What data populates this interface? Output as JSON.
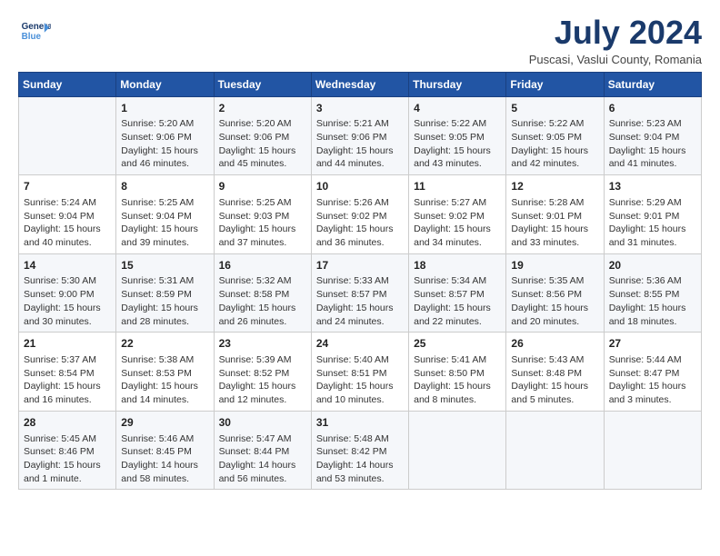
{
  "header": {
    "logo_line1": "General",
    "logo_line2": "Blue",
    "month": "July 2024",
    "location": "Puscasi, Vaslui County, Romania"
  },
  "days_of_week": [
    "Sunday",
    "Monday",
    "Tuesday",
    "Wednesday",
    "Thursday",
    "Friday",
    "Saturday"
  ],
  "weeks": [
    [
      {
        "day": "",
        "info": ""
      },
      {
        "day": "1",
        "info": "Sunrise: 5:20 AM\nSunset: 9:06 PM\nDaylight: 15 hours\nand 46 minutes."
      },
      {
        "day": "2",
        "info": "Sunrise: 5:20 AM\nSunset: 9:06 PM\nDaylight: 15 hours\nand 45 minutes."
      },
      {
        "day": "3",
        "info": "Sunrise: 5:21 AM\nSunset: 9:06 PM\nDaylight: 15 hours\nand 44 minutes."
      },
      {
        "day": "4",
        "info": "Sunrise: 5:22 AM\nSunset: 9:05 PM\nDaylight: 15 hours\nand 43 minutes."
      },
      {
        "day": "5",
        "info": "Sunrise: 5:22 AM\nSunset: 9:05 PM\nDaylight: 15 hours\nand 42 minutes."
      },
      {
        "day": "6",
        "info": "Sunrise: 5:23 AM\nSunset: 9:04 PM\nDaylight: 15 hours\nand 41 minutes."
      }
    ],
    [
      {
        "day": "7",
        "info": "Sunrise: 5:24 AM\nSunset: 9:04 PM\nDaylight: 15 hours\nand 40 minutes."
      },
      {
        "day": "8",
        "info": "Sunrise: 5:25 AM\nSunset: 9:04 PM\nDaylight: 15 hours\nand 39 minutes."
      },
      {
        "day": "9",
        "info": "Sunrise: 5:25 AM\nSunset: 9:03 PM\nDaylight: 15 hours\nand 37 minutes."
      },
      {
        "day": "10",
        "info": "Sunrise: 5:26 AM\nSunset: 9:02 PM\nDaylight: 15 hours\nand 36 minutes."
      },
      {
        "day": "11",
        "info": "Sunrise: 5:27 AM\nSunset: 9:02 PM\nDaylight: 15 hours\nand 34 minutes."
      },
      {
        "day": "12",
        "info": "Sunrise: 5:28 AM\nSunset: 9:01 PM\nDaylight: 15 hours\nand 33 minutes."
      },
      {
        "day": "13",
        "info": "Sunrise: 5:29 AM\nSunset: 9:01 PM\nDaylight: 15 hours\nand 31 minutes."
      }
    ],
    [
      {
        "day": "14",
        "info": "Sunrise: 5:30 AM\nSunset: 9:00 PM\nDaylight: 15 hours\nand 30 minutes."
      },
      {
        "day": "15",
        "info": "Sunrise: 5:31 AM\nSunset: 8:59 PM\nDaylight: 15 hours\nand 28 minutes."
      },
      {
        "day": "16",
        "info": "Sunrise: 5:32 AM\nSunset: 8:58 PM\nDaylight: 15 hours\nand 26 minutes."
      },
      {
        "day": "17",
        "info": "Sunrise: 5:33 AM\nSunset: 8:57 PM\nDaylight: 15 hours\nand 24 minutes."
      },
      {
        "day": "18",
        "info": "Sunrise: 5:34 AM\nSunset: 8:57 PM\nDaylight: 15 hours\nand 22 minutes."
      },
      {
        "day": "19",
        "info": "Sunrise: 5:35 AM\nSunset: 8:56 PM\nDaylight: 15 hours\nand 20 minutes."
      },
      {
        "day": "20",
        "info": "Sunrise: 5:36 AM\nSunset: 8:55 PM\nDaylight: 15 hours\nand 18 minutes."
      }
    ],
    [
      {
        "day": "21",
        "info": "Sunrise: 5:37 AM\nSunset: 8:54 PM\nDaylight: 15 hours\nand 16 minutes."
      },
      {
        "day": "22",
        "info": "Sunrise: 5:38 AM\nSunset: 8:53 PM\nDaylight: 15 hours\nand 14 minutes."
      },
      {
        "day": "23",
        "info": "Sunrise: 5:39 AM\nSunset: 8:52 PM\nDaylight: 15 hours\nand 12 minutes."
      },
      {
        "day": "24",
        "info": "Sunrise: 5:40 AM\nSunset: 8:51 PM\nDaylight: 15 hours\nand 10 minutes."
      },
      {
        "day": "25",
        "info": "Sunrise: 5:41 AM\nSunset: 8:50 PM\nDaylight: 15 hours\nand 8 minutes."
      },
      {
        "day": "26",
        "info": "Sunrise: 5:43 AM\nSunset: 8:48 PM\nDaylight: 15 hours\nand 5 minutes."
      },
      {
        "day": "27",
        "info": "Sunrise: 5:44 AM\nSunset: 8:47 PM\nDaylight: 15 hours\nand 3 minutes."
      }
    ],
    [
      {
        "day": "28",
        "info": "Sunrise: 5:45 AM\nSunset: 8:46 PM\nDaylight: 15 hours\nand 1 minute."
      },
      {
        "day": "29",
        "info": "Sunrise: 5:46 AM\nSunset: 8:45 PM\nDaylight: 14 hours\nand 58 minutes."
      },
      {
        "day": "30",
        "info": "Sunrise: 5:47 AM\nSunset: 8:44 PM\nDaylight: 14 hours\nand 56 minutes."
      },
      {
        "day": "31",
        "info": "Sunrise: 5:48 AM\nSunset: 8:42 PM\nDaylight: 14 hours\nand 53 minutes."
      },
      {
        "day": "",
        "info": ""
      },
      {
        "day": "",
        "info": ""
      },
      {
        "day": "",
        "info": ""
      }
    ]
  ]
}
